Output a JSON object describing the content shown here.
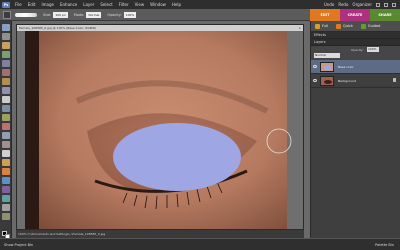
{
  "app": {
    "logo_text": "Ps"
  },
  "menu": {
    "items": [
      "File",
      "Edit",
      "Image",
      "Enhance",
      "Layer",
      "Select",
      "Filter",
      "View",
      "Window",
      "Help"
    ],
    "right": {
      "undo": "Undo",
      "redo": "Redo",
      "organizer": "Organizer"
    }
  },
  "options_bar": {
    "size_label": "Size:",
    "size_value": "100 px",
    "mode_label": "Mode:",
    "mode_value": "Normal",
    "opacity_label": "Opacity:",
    "opacity_value": "100%"
  },
  "mode_tabs": [
    "EDIT",
    "CREATE",
    "SHARE"
  ],
  "panel": {
    "subtabs": [
      {
        "label": "Full",
        "color": "#d8a020"
      },
      {
        "label": "Quick",
        "color": "#e07820"
      },
      {
        "label": "Guided",
        "color": "#60a030"
      }
    ],
    "effects_header": "Effects",
    "layers_header": "Layers",
    "blend_label": "Normal",
    "opacity_label": "Opacity:",
    "opacity_value": "100%",
    "layers": [
      {
        "name": "Base color",
        "selected": true,
        "locked": false
      },
      {
        "name": "Background",
        "selected": false,
        "locked": true
      }
    ]
  },
  "document": {
    "title": "Female_108585_0.jpg @ 100% (Base Color, RGB/8)",
    "status": "100%    C:\\Documents and Settings\\..\\Female_108585_0.jpg",
    "zoom": "100%"
  },
  "bin": {
    "left": "Show Project Bin",
    "right": "Palette Bin"
  },
  "colors": {
    "edit_tab": "#e07820",
    "create_tab": "#b03080",
    "share_tab": "#5a8a30",
    "selected_layer": "#5d6b86",
    "paint_overlay": "#9fa6e4"
  }
}
